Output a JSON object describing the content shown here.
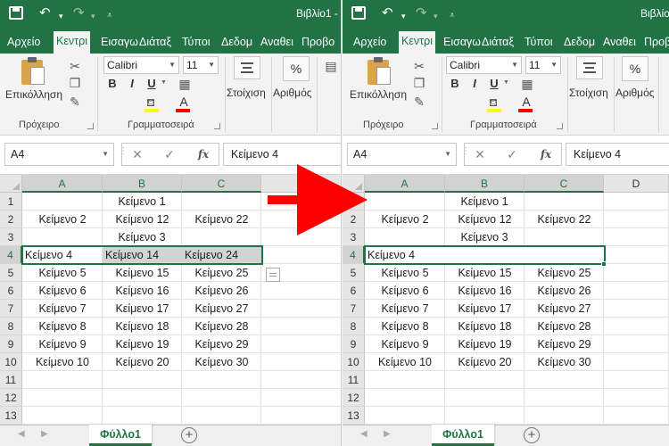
{
  "app": {
    "title": "Βιβλίο1 -",
    "tabs": [
      "Αρχείο",
      "Κεντρι",
      "Εισαγω",
      "Διάταξ",
      "Τύποι",
      "Δεδομ",
      "Αναθει",
      "Προβο"
    ],
    "active_tab_index": 1
  },
  "ribbon": {
    "paste_label": "Επικόλληση",
    "clipboard_label": "Πρόχειρο",
    "font_name": "Calibri",
    "font_size": "11",
    "bold_label": "B",
    "italic_label": "I",
    "underline_label": "U",
    "font_group_label": "Γραμματοσειρά",
    "alignment_label": "Στοίχιση",
    "number_label": "Αριθμός",
    "percent_symbol": "%",
    "fill_color": "#ffff00",
    "font_color": "#ff0000"
  },
  "formula_bar": {
    "name_box": "A4",
    "fx_label": "fx",
    "cancel_icon": "✕",
    "enter_icon": "✓",
    "content": "Κείμενο 4"
  },
  "columns": [
    "A",
    "B",
    "C",
    "D"
  ],
  "rows": [
    "1",
    "2",
    "3",
    "4",
    "5",
    "6",
    "7",
    "8",
    "9",
    "10",
    "11",
    "12",
    "13"
  ],
  "before": {
    "r1": "Κείμενο 1",
    "r2": [
      "Κείμενο 2",
      "Κείμενο 12",
      "Κείμενο 22"
    ],
    "r3": "Κείμενο 3",
    "r4": [
      "Κείμενο 4",
      "Κείμενο 14",
      "Κείμενο 24"
    ],
    "r5": [
      "Κείμενο 5",
      "Κείμενο 15",
      "Κείμενο 25"
    ],
    "r6": [
      "Κείμενο 6",
      "Κείμενο 16",
      "Κείμενο 26"
    ],
    "r7": [
      "Κείμενο 7",
      "Κείμενο 17",
      "Κείμενο 27"
    ],
    "r8": [
      "Κείμενο 8",
      "Κείμενο 18",
      "Κείμενο 28"
    ],
    "r9": [
      "Κείμενο 9",
      "Κείμενο 19",
      "Κείμενο 29"
    ],
    "r10": [
      "Κείμενο 10",
      "Κείμενο 20",
      "Κείμενο 30"
    ]
  },
  "after": {
    "r1": "Κείμενο 1",
    "r2": [
      "Κείμενο 2",
      "Κείμενο 12",
      "Κείμενο 22"
    ],
    "r3": "Κείμενο 3",
    "r4": "Κείμενο 4",
    "r5": [
      "Κείμενο 5",
      "Κείμενο 15",
      "Κείμενο 25"
    ],
    "r6": [
      "Κείμενο 6",
      "Κείμενο 16",
      "Κείμενο 26"
    ],
    "r7": [
      "Κείμενο 7",
      "Κείμενο 17",
      "Κείμενο 27"
    ],
    "r8": [
      "Κείμενο 8",
      "Κείμενο 18",
      "Κείμενο 28"
    ],
    "r9": [
      "Κείμενο 9",
      "Κείμενο 19",
      "Κείμενο 29"
    ],
    "r10": [
      "Κείμενο 10",
      "Κείμενο 20",
      "Κείμενο 30"
    ]
  },
  "sheet_tab": "Φύλλο1",
  "add_sheet_symbol": "+",
  "colors": {
    "excel_green": "#217346",
    "arrow_red": "#ff0000",
    "selection_gray": "#d3d3d3"
  }
}
